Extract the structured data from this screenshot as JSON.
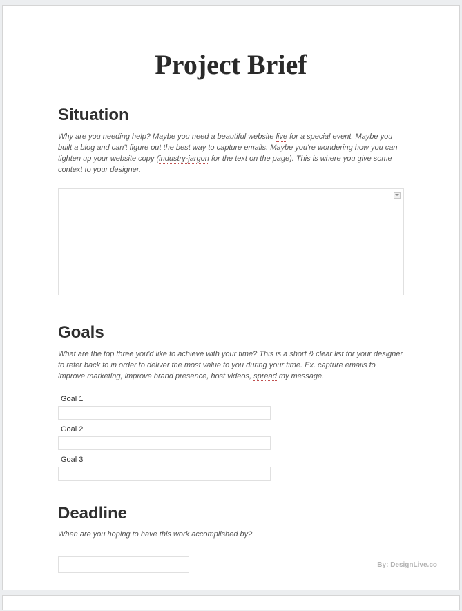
{
  "title": "Project Brief",
  "situation": {
    "heading": "Situation",
    "desc_parts": [
      "Why are you needing help? Maybe you need a beautiful website ",
      "live",
      " for a special event. Maybe you built a blog and can't figure out the best way to capture emails. Maybe you're wondering how you can tighten up your website copy (",
      "industry-jargon",
      " for the text on the page). This is where you give some context to your designer."
    ]
  },
  "goals": {
    "heading": "Goals",
    "desc_parts": [
      "What are the top three you'd like to achieve with your time? This is a short & clear list for your designer to refer back to in order to deliver the most value to you during your time. Ex. capture emails to improve marketing, improve brand presence, host videos, ",
      "spread",
      " my message."
    ],
    "items": [
      {
        "label": "Goal 1",
        "value": ""
      },
      {
        "label": "Goal 2",
        "value": ""
      },
      {
        "label": "Goal 3",
        "value": ""
      }
    ]
  },
  "deadline": {
    "heading": "Deadline",
    "desc_parts": [
      "When are you hoping to have this work accomplished ",
      "by",
      "?"
    ],
    "value": ""
  },
  "footer": "By: DesignLive.co"
}
